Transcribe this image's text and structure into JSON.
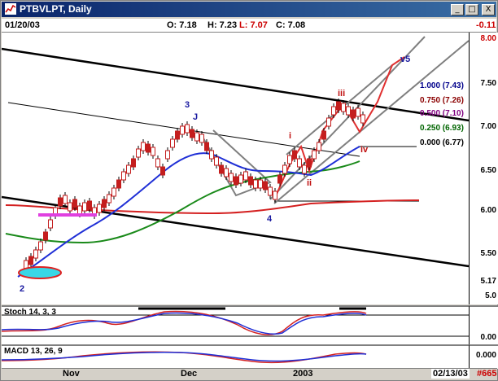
{
  "window": {
    "title": "PTBVLPT, Daily",
    "buttons": [
      "_",
      "□",
      "X"
    ]
  },
  "infobar": {
    "date": "01/20/03",
    "open": "O: 7.18",
    "high": "H: 7.23",
    "low": "L: 7.07",
    "close": "C: 7.08",
    "change": "-0.11"
  },
  "main_axis": {
    "ticks": [
      "8.00",
      "7.50",
      "7.00",
      "6.50",
      "6.00",
      "5.50"
    ],
    "last_price": "5.17",
    "bottom_label": "5.0"
  },
  "fib_levels": [
    {
      "label": "1.000 (7.43)",
      "color": "#00008b"
    },
    {
      "label": "0.750 (7.26)",
      "color": "#8b0000"
    },
    {
      "label": "0.500 (7.10)",
      "color": "#800080"
    },
    {
      "label": "0.250 (6.93)",
      "color": "#006400"
    },
    {
      "label": "0.000 (6.77)",
      "color": "#000000"
    }
  ],
  "wave_labels": {
    "w2": "2",
    "w3": "3",
    "wJ": "J",
    "w4": "4",
    "wi": "i",
    "wii": "ii",
    "wiii": "iii",
    "wiv": "iv",
    "wv": "v5"
  },
  "stoch": {
    "title": "Stoch 14, 3, 3",
    "axis_label": "0.00"
  },
  "macd": {
    "title": "MACD 13, 26, 9",
    "axis_label": "0.000"
  },
  "dates": {
    "nov": "Nov",
    "dec": "Dec",
    "year": "2003",
    "end": "02/13/03",
    "ref": "#665"
  },
  "colors": {
    "ma_blue": "#1f2fd6",
    "ma_green": "#1a8a1a",
    "ma_red": "#d42020",
    "candle": "#c41e1e",
    "channel": "#7f7f7f"
  }
}
